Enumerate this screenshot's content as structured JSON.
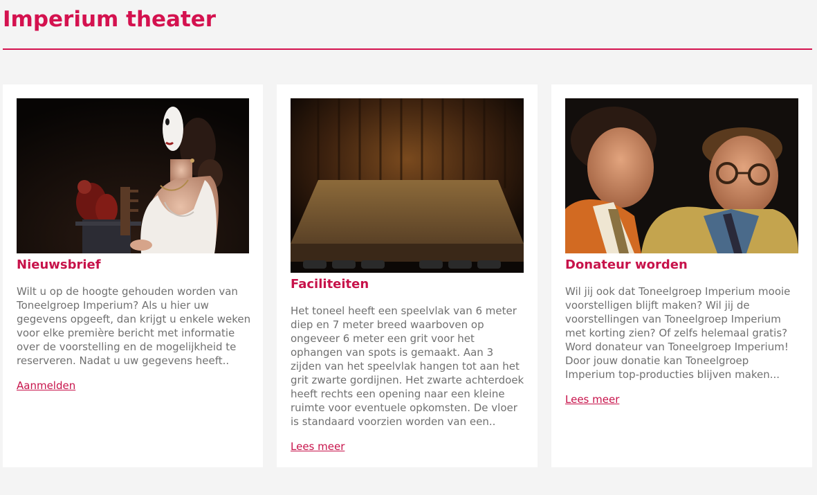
{
  "site": {
    "title": "Imperium theater",
    "accent_color": "#d4124f",
    "background_color": "#f4f4f4"
  },
  "cards": [
    {
      "image_description_icon": "photo-masked-actress",
      "title": "Nieuwsbrief",
      "text": "Wilt u op de hoogte gehouden worden van Toneelgroep Imperium? Als u hier uw gegevens opgeeft, dan krijgt u enkele weken voor elke première bericht met informatie over de voorstelling en de mogelijkheid te reserveren. Nadat u uw gegevens heeft..",
      "link_label": "Aanmelden"
    },
    {
      "image_description_icon": "photo-empty-stage",
      "title": "Faciliteiten",
      "text": "Het toneel heeft een speelvlak van 6 meter diep en 7 meter breed waarboven op ongeveer 6 meter een grit voor het ophangen van spots is gemaakt. Aan 3 zijden van het speelvlak hangen tot aan het grit zwarte gordijnen. Het zwarte achterdoek heeft rechts een opening naar een kleine ruimte voor eventuele opkomsten. De vloer is standaard voorzien worden van een..",
      "link_label": "Lees meer"
    },
    {
      "image_description_icon": "photo-two-actors",
      "title": "Donateur worden",
      "text": "Wil jij ook dat Toneelgroep Imperium mooie voorstelligen blijft maken? Wil jij de voorstellingen van Toneelgroep Imperium met korting zien? Of zelfs helemaal gratis? Word donateur van Toneelgroep Imperium! Door jouw donatie kan Toneelgroep Imperium top-producties blijven maken...",
      "link_label": "Lees meer"
    }
  ]
}
